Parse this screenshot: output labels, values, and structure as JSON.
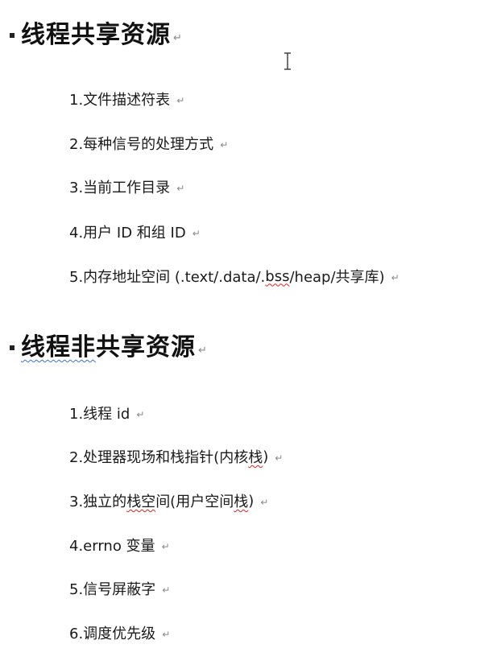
{
  "shared_section": {
    "title": "线程共享资源",
    "items": [
      "1.文件描述符表",
      "2.每种信号的处理方式",
      "3.当前工作目录",
      "4.用户 ID 和组 ID",
      {
        "prefix": "5.内存地址空间  (.text/.data/.",
        "underlined": "bss",
        "suffix": "/heap/共享库)"
      }
    ]
  },
  "nonshared_section": {
    "title_underlined": "线程非",
    "title_rest": "共享资源",
    "items": [
      "1.线程 id",
      {
        "prefix": "2.处理器现场和栈指针(内核",
        "underlined": "栈",
        "suffix": ")"
      },
      {
        "prefix": "3.独立的",
        "underlined": "栈空",
        "middle": "间(用户空间",
        "underlined2": "栈",
        "suffix": ")"
      },
      "4.errno 变量",
      "5.信号屏蔽字",
      "6.调度优先级"
    ]
  },
  "mark_glyph": "↵"
}
